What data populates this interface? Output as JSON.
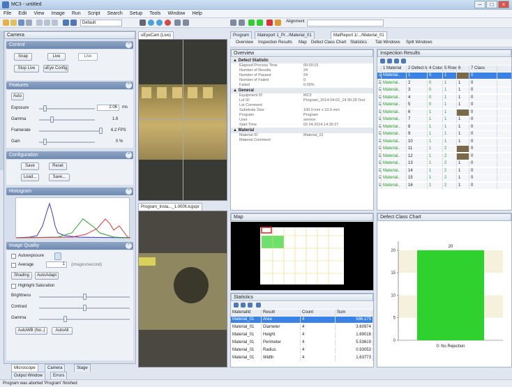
{
  "window": {
    "title": "MC3 - untitled"
  },
  "menu": [
    "File",
    "Edit",
    "View",
    "Image",
    "Run",
    "Script",
    "Search",
    "Setup",
    "Tools",
    "Window",
    "Help"
  ],
  "toolbar": {
    "layout_label": "Default",
    "alignment_label": "Alignment"
  },
  "camera_panel": {
    "title": "Camera",
    "control": {
      "title": "Control",
      "snap": "Snap",
      "live": "Live",
      "stop_live": "Stop Live",
      "config": "uEye Config",
      "live_field": "Live"
    },
    "features": {
      "title": "Features",
      "auto": "Auto",
      "exposure_label": "Exposure",
      "exposure_value": "2.06",
      "exposure_unit": "ms",
      "gamma_label": "Gamma",
      "gamma_value": "1.6",
      "framerate_label": "Framerate",
      "framerate_value": "6.2 FPS",
      "gain_label": "Gain",
      "gain_value": "0 %"
    },
    "configuration": {
      "title": "Configuration",
      "save": "Save",
      "reset": "Reset",
      "load": "Load...",
      "save_as": "Save..."
    },
    "histogram": {
      "title": "Histogram"
    },
    "image_quality": {
      "title": "Image Quality",
      "autoexposure": "Autoexposure",
      "average": "Average",
      "average_value": "1",
      "average_note": "(images/second)",
      "shading": "Shading",
      "autoadapt": "AutoAdapt",
      "highlight": "Highlight Saturation",
      "brightness": "Brightness",
      "contrast": "Contrast",
      "gamma": "Gamma",
      "btn_a": "AutoWB (No..)",
      "btn_b": "AutoAll"
    }
  },
  "bottom_tabs": [
    "Microscope",
    "Camera",
    "Stage"
  ],
  "bottom_tabs2": [
    "Output Window",
    "Errors"
  ],
  "image_tabs": {
    "top": "uEyeCam (Live)",
    "bottom": "Program_Insta..._1.000fi.tcgxpr"
  },
  "doc_tabs": [
    "Program",
    "Matreport 1_Pr.../Material_01",
    "MatReport 1/.../Material_01"
  ],
  "sub_tabs": [
    "Overview",
    "Inspection Results",
    "Map",
    "Defect Class Chart",
    "Statistics",
    "Tab Windows",
    "Split Windows"
  ],
  "overview": {
    "title": "Overview",
    "sections": [
      {
        "name": "Defect Statistic",
        "rows": [
          [
            "Elapsed Process Time",
            "00:00:15"
          ],
          [
            "Number of Results",
            "24"
          ],
          [
            "Number of Passed",
            "24"
          ],
          [
            "Number of Failed",
            "0"
          ],
          [
            "Failed",
            "0.00%"
          ]
        ]
      },
      {
        "name": "General",
        "rows": [
          [
            "Equipment ID",
            "MC3"
          ],
          [
            "Lot ID",
            "Program_2014-04-02_14:30:28 Test"
          ],
          [
            "Lot Comment",
            ""
          ],
          [
            "Substrate Size",
            "100.0 mm x 10.0 mm"
          ],
          [
            "Program",
            "Program"
          ],
          [
            "User",
            "service"
          ],
          [
            "Start Time",
            "02.04.2014 14:30:27"
          ]
        ]
      },
      {
        "name": "Material",
        "rows": [
          [
            "Material ID",
            "Material_01"
          ],
          [
            "Material Comment",
            ""
          ]
        ]
      }
    ]
  },
  "inspection": {
    "title": "Inspection Results",
    "headers": [
      "",
      "1 Material",
      "2 Defect Id",
      "4 Column",
      "5 Row",
      "6",
      "7 Class"
    ],
    "rows": [
      [
        "Material..",
        "1",
        "0",
        "1",
        "1",
        "0"
      ],
      [
        "Material..",
        "2",
        "0",
        "1",
        "1",
        "0"
      ],
      [
        "Material..",
        "3",
        "0",
        "1",
        "1",
        "0"
      ],
      [
        "Material..",
        "4",
        "0",
        "1",
        "1",
        "0"
      ],
      [
        "Material..",
        "5",
        "0",
        "1",
        "1",
        "0"
      ],
      [
        "Material..",
        "6",
        "1",
        "1",
        "1",
        "0"
      ],
      [
        "Material..",
        "7",
        "1",
        "1",
        "1",
        "0"
      ],
      [
        "Material..",
        "8",
        "1",
        "1",
        "1",
        "0"
      ],
      [
        "Material..",
        "9",
        "1",
        "1",
        "1",
        "0"
      ],
      [
        "Material..",
        "10",
        "1",
        "1",
        "1",
        "0"
      ],
      [
        "Material..",
        "11",
        "1",
        "2",
        "1",
        "0"
      ],
      [
        "Material..",
        "12",
        "1",
        "2",
        "1",
        "0"
      ],
      [
        "Material..",
        "13",
        "1",
        "2",
        "1",
        "0"
      ],
      [
        "Material..",
        "14",
        "1",
        "2",
        "1",
        "0"
      ],
      [
        "Material..",
        "15",
        "1",
        "2",
        "1",
        "0"
      ],
      [
        "Material..",
        "16",
        "1",
        "2",
        "1",
        "0"
      ]
    ]
  },
  "map_panel": {
    "title": "Map"
  },
  "statistics": {
    "title": "Statistics",
    "headers": [
      "MaterialId",
      "Result",
      "Count",
      "Sum"
    ],
    "rows": [
      [
        "Material_01",
        "Area",
        "4",
        "586.175"
      ],
      [
        "Material_01",
        "Diameter",
        "4",
        "3.60974"
      ],
      [
        "Material_01",
        "Height",
        "4",
        "1.69018"
      ],
      [
        "Material_01",
        "Perimeter",
        "4",
        "5.53619"
      ],
      [
        "Material_01",
        "Radius",
        "4",
        "0.93053"
      ],
      [
        "Material_01",
        "Width",
        "4",
        "1.63773"
      ]
    ]
  },
  "defect_chart": {
    "title": "Defect Class Chart",
    "chart_data": {
      "type": "bar",
      "categories": [
        "0: No Rejection"
      ],
      "values": [
        20
      ],
      "ylim": [
        0,
        22
      ],
      "yticks": [
        0,
        5,
        10,
        15,
        20
      ],
      "data_labels": [
        "20"
      ],
      "color": "#2fd12f"
    }
  },
  "statusbar": {
    "text": "Program was aborted 'Program' finished"
  }
}
